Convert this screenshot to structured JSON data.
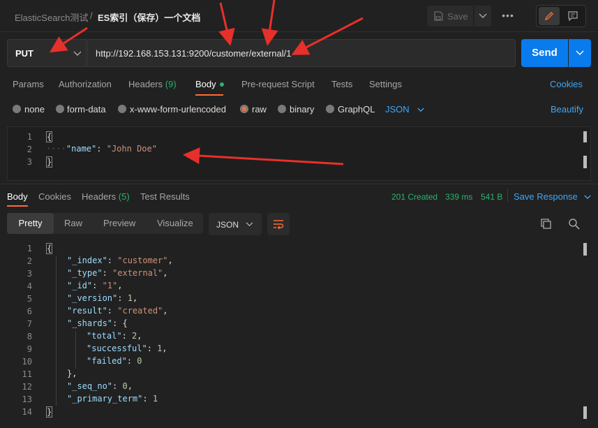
{
  "header": {
    "crumb_parent": "ElasticSearch测试",
    "crumb_sep": "/",
    "crumb_current": "ES索引（保存）一个文档",
    "save_label": "Save",
    "more_label": "•••"
  },
  "request": {
    "method": "PUT",
    "url": "http://192.168.153.131:9200/customer/external/1",
    "send_label": "Send"
  },
  "req_tabs": {
    "params": "Params",
    "authorization": "Authorization",
    "headers": "Headers",
    "headers_count": "(9)",
    "body": "Body",
    "prerequest": "Pre-request Script",
    "tests": "Tests",
    "settings": "Settings",
    "cookies": "Cookies"
  },
  "body_types": {
    "none": "none",
    "form_data": "form-data",
    "urlencoded": "x-www-form-urlencoded",
    "raw": "raw",
    "binary": "binary",
    "graphql": "GraphQL",
    "format": "JSON",
    "beautify": "Beautify",
    "selected": "raw"
  },
  "request_body": {
    "line_numbers": [
      "1",
      "2",
      "3"
    ],
    "open": "{",
    "key": "\"name\"",
    "colon": ": ",
    "value": "\"John Doe\"",
    "close": "}"
  },
  "response": {
    "tabs": {
      "body": "Body",
      "cookies": "Cookies",
      "headers": "Headers",
      "headers_count": "(5)",
      "test_results": "Test Results"
    },
    "status": "201 Created",
    "time": "339 ms",
    "size": "541 B",
    "save_response": "Save Response",
    "views": {
      "pretty": "Pretty",
      "raw": "Raw",
      "preview": "Preview",
      "visualize": "Visualize"
    },
    "format": "JSON",
    "line_numbers": [
      "1",
      "2",
      "3",
      "4",
      "5",
      "6",
      "7",
      "8",
      "9",
      "10",
      "11",
      "12",
      "13",
      "14"
    ],
    "lines": [
      {
        "k": "\"_index\"",
        "v": "\"customer\"",
        "t": "s"
      },
      {
        "k": "\"_type\"",
        "v": "\"external\"",
        "t": "s"
      },
      {
        "k": "\"_id\"",
        "v": "\"1\"",
        "t": "s"
      },
      {
        "k": "\"_version\"",
        "v": "1",
        "t": "n"
      },
      {
        "k": "\"result\"",
        "v": "\"created\"",
        "t": "s"
      },
      {
        "k": "\"_shards\"",
        "v": "{",
        "t": "p"
      },
      {
        "k": "\"total\"",
        "v": "2",
        "t": "n"
      },
      {
        "k": "\"successful\"",
        "v": "1",
        "t": "n"
      },
      {
        "k": "\"failed\"",
        "v": "0",
        "t": "n"
      },
      {
        "k": "\"_seq_no\"",
        "v": "0",
        "t": "n"
      },
      {
        "k": "\"_primary_term\"",
        "v": "1",
        "t": "n"
      }
    ],
    "open": "{",
    "shards_close": "},",
    "close": "}"
  },
  "colors": {
    "accent": "#ff6c37",
    "send_blue": "#097bed",
    "link_blue": "#3ea7f7",
    "success_green": "#29b36b",
    "annotation_red": "#e8302a"
  }
}
